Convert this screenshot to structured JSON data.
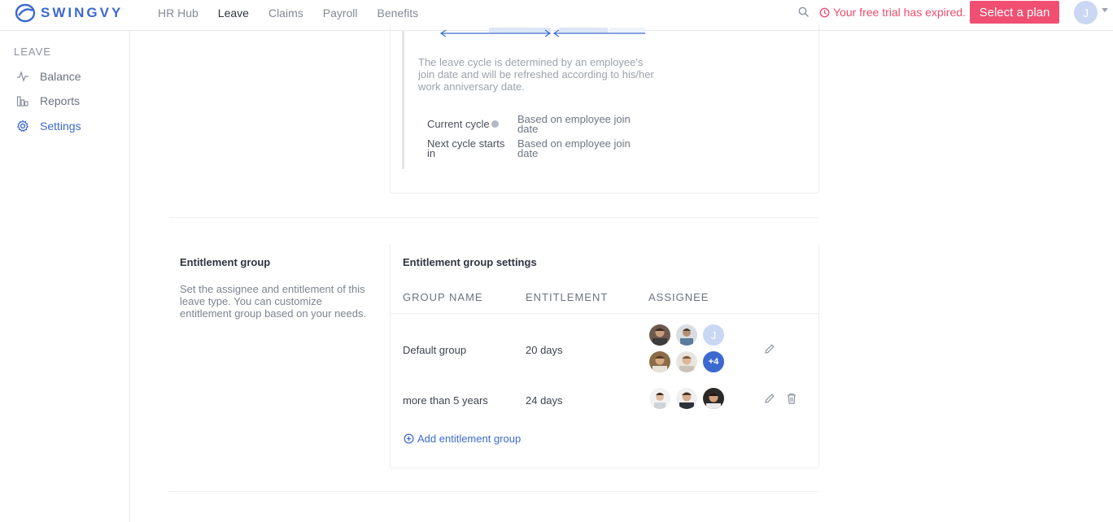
{
  "brand": {
    "name": "SWINGVY",
    "color": "#3c69d0"
  },
  "topnav": {
    "items": [
      {
        "label": "HR Hub",
        "active": false
      },
      {
        "label": "Leave",
        "active": true
      },
      {
        "label": "Claims",
        "active": false
      },
      {
        "label": "Payroll",
        "active": false
      },
      {
        "label": "Benefits",
        "active": false
      }
    ],
    "trial_text": "Your free trial has expired.",
    "plan_button": "Select a plan",
    "user_initial": "J"
  },
  "sidebar": {
    "heading": "LEAVE",
    "items": [
      {
        "label": "Balance",
        "icon": "activity-icon",
        "active": false
      },
      {
        "label": "Reports",
        "icon": "bar-chart-icon",
        "active": false
      },
      {
        "label": "Settings",
        "icon": "gear-icon",
        "active": true
      }
    ]
  },
  "cycle": {
    "description": "The leave cycle is determined by an employee's join date and will be refreshed according to his/her work anniversary date.",
    "current_cycle_label": "Current cycle",
    "current_cycle_value": "Based on employee join date",
    "next_cycle_label": "Next cycle starts in",
    "next_cycle_value": "Based on employee join date"
  },
  "entitlement": {
    "title": "Entitlement group",
    "description": "Set the assignee and entitlement of this leave type. You can customize entitlement group based on your needs.",
    "settings_title": "Entitlement group settings",
    "columns": [
      "GROUP NAME",
      "ENTITLEMENT",
      "ASSIGNEE"
    ],
    "rows": [
      {
        "group_name": "Default group",
        "entitlement": "20 days",
        "more_label": "+4",
        "initial": "J",
        "deletable": false
      },
      {
        "group_name": "more than 5 years",
        "entitlement": "24 days",
        "deletable": true
      }
    ],
    "add_label": "Add entitlement group"
  },
  "colors": {
    "accent": "#3c69d0",
    "alert": "#f04f72"
  }
}
